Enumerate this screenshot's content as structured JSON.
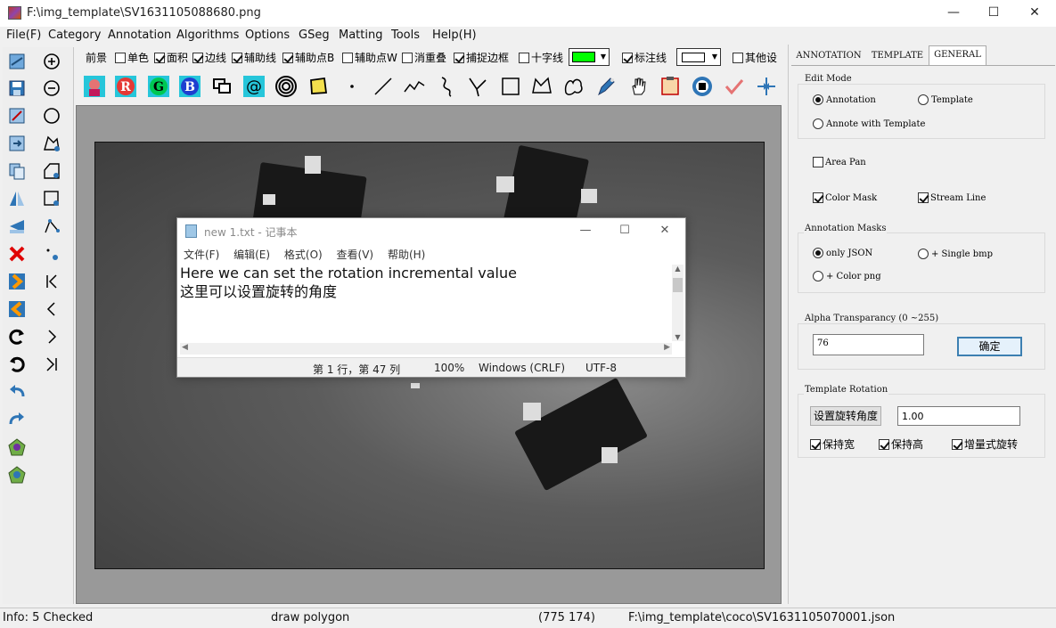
{
  "window": {
    "title": "F:\\img_template\\SV1631105088680.png",
    "minimize": "—",
    "maximize": "☐",
    "close": "✕"
  },
  "menu": [
    "File(F)",
    "Category",
    "Annotation",
    "Algorithms",
    "Options",
    "GSeg",
    "Matting",
    "Tools",
    "Help(H)"
  ],
  "options": {
    "foreground": "前景",
    "items": [
      {
        "label": "单色",
        "checked": false
      },
      {
        "label": "面积",
        "checked": true
      },
      {
        "label": "边线",
        "checked": true
      },
      {
        "label": "辅助线",
        "checked": true
      },
      {
        "label": "辅助点B",
        "checked": true
      },
      {
        "label": "辅助点W",
        "checked": false
      },
      {
        "label": "消重叠",
        "checked": false
      },
      {
        "label": "捕捉边框",
        "checked": true
      },
      {
        "label": "十字线",
        "checked": false
      },
      {
        "label": "标注线",
        "checked": true
      },
      {
        "label": "其他设",
        "checked": false
      }
    ],
    "fg_color": "#00ff00",
    "line_color": "#ffffff"
  },
  "tools": [
    "photo",
    "R",
    "G",
    "B",
    "speech",
    "@",
    "rings",
    "skew",
    "dot",
    "line",
    "polyline",
    "curve",
    "cutline",
    "rect",
    "polygon",
    "freehand",
    "pen",
    "hand",
    "frame",
    "stop",
    "check",
    "split"
  ],
  "notepad": {
    "title": "new 1.txt - 记事本",
    "menu": [
      "文件(F)",
      "编辑(E)",
      "格式(O)",
      "查看(V)",
      "帮助(H)"
    ],
    "lines": [
      "Here we can set the rotation incremental value",
      "这里可以设置旋转的角度"
    ],
    "status": {
      "position": "第 1 行，第 47 列",
      "zoom": "100%",
      "eol": "Windows (CRLF)",
      "encoding": "UTF-8"
    }
  },
  "panel": {
    "tabs": [
      "ANNOTATION",
      "TEMPLATE",
      "GENERAL"
    ],
    "active_tab": "GENERAL",
    "edit_mode": {
      "label": "Edit Mode",
      "annotation": "Annotation",
      "template": "Template",
      "annote_with_template": "Annote with Template"
    },
    "area_pan": "Area Pan",
    "color_mask": "Color Mask",
    "stream_line": "Stream Line",
    "masks": {
      "label": "Annotation Masks",
      "only_json": "only JSON",
      "single_bmp": "+ Single bmp",
      "color_png": "+ Color png"
    },
    "alpha": {
      "label": "Alpha Transparancy (0 ~255)",
      "value": "76",
      "ok": "确定"
    },
    "rotation": {
      "label": "Template Rotation",
      "button": "设置旋转角度",
      "value": "1.00",
      "keep_width": "保持宽",
      "keep_height": "保持高",
      "incremental": "增量式旋转"
    }
  },
  "status": {
    "info": "Info: 5 Checked",
    "mode": "draw polygon",
    "coords": "(775  174)",
    "path": "F:\\img_template\\coco\\SV1631105070001.json"
  }
}
